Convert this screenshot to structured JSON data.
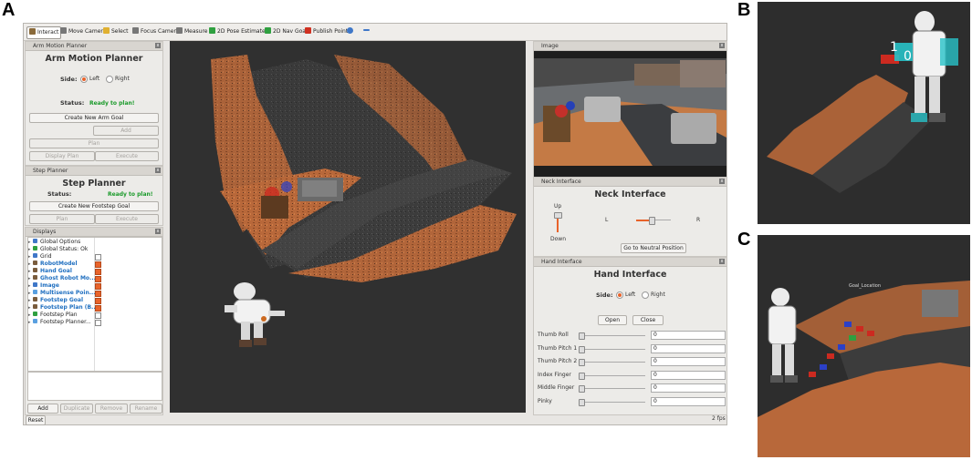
{
  "figure_letters": {
    "a": "A",
    "b": "B",
    "c": "C"
  },
  "toolbar": [
    {
      "label": "Interact",
      "icon": "hand-icon",
      "color": "#8a6a3a"
    },
    {
      "label": "Move Camera",
      "icon": "move-camera-icon",
      "color": "#777777"
    },
    {
      "label": "Select",
      "icon": "select-icon",
      "color": "#e0b030"
    },
    {
      "label": "Focus Camera",
      "icon": "focus-camera-icon",
      "color": "#777777"
    },
    {
      "label": "Measure",
      "icon": "measure-icon",
      "color": "#777777"
    },
    {
      "label": "2D Pose Estimate",
      "icon": "pose-estimate-icon",
      "color": "#2fa040"
    },
    {
      "label": "2D Nav Goal",
      "icon": "nav-goal-icon",
      "color": "#2fa040"
    },
    {
      "label": "Publish Point",
      "icon": "publish-point-icon",
      "color": "#d03020"
    }
  ],
  "arm_planner": {
    "panel_title": "Arm Motion Planner",
    "heading": "Arm Motion Planner",
    "side_label": "Side:",
    "left": "Left",
    "right": "Right",
    "status_label": "Status:",
    "status_value": "Ready to plan!",
    "create_goal": "Create New Arm Goal",
    "add": "Add",
    "plan": "Plan",
    "display_plan": "Display Plan",
    "execute": "Execute"
  },
  "step_planner": {
    "panel_title": "Step Planner",
    "heading": "Step Planner",
    "status_label": "Status:",
    "status_value": "Ready to plan!",
    "create_goal": "Create New Footstep Goal",
    "plan": "Plan",
    "execute": "Execute"
  },
  "displays": {
    "panel_title": "Displays",
    "items": [
      {
        "label": "Global Options",
        "icon_color": "#3f77c8",
        "checkbox": "none",
        "blue": false
      },
      {
        "label": "Global Status: Ok",
        "icon_color": "#2fa040",
        "checkbox": "none",
        "blue": false
      },
      {
        "label": "Grid",
        "icon_color": "#3f77c8",
        "checkbox": "off",
        "blue": false
      },
      {
        "label": "RobotModel",
        "icon_color": "#7a5c3c",
        "checkbox": "on",
        "blue": true
      },
      {
        "label": "Hand Goal",
        "icon_color": "#7a5c3c",
        "checkbox": "on",
        "blue": true
      },
      {
        "label": "Ghost Robot Mo...",
        "icon_color": "#7a5c3c",
        "checkbox": "on",
        "blue": true
      },
      {
        "label": "Image",
        "icon_color": "#3f77c8",
        "checkbox": "on",
        "blue": true
      },
      {
        "label": "Multisense Poin...",
        "icon_color": "#5aa0e0",
        "checkbox": "on",
        "blue": true
      },
      {
        "label": "Footstep Goal",
        "icon_color": "#7a5c3c",
        "checkbox": "on",
        "blue": true
      },
      {
        "label": "Footstep Plan (B...",
        "icon_color": "#7a5c3c",
        "checkbox": "on",
        "blue": true
      },
      {
        "label": "Footstep Plan",
        "icon_color": "#2fa040",
        "checkbox": "off",
        "blue": false
      },
      {
        "label": "Footstep Planner...",
        "icon_color": "#5aa0e0",
        "checkbox": "off",
        "blue": false
      }
    ],
    "add": "Add",
    "duplicate": "Duplicate",
    "remove": "Remove",
    "rename": "Rename"
  },
  "reset": "Reset",
  "fps": "2 fps",
  "image_panel": {
    "panel_title": "Image"
  },
  "neck": {
    "panel_title": "Neck Interface",
    "heading": "Neck Interface",
    "up": "Up",
    "down": "Down",
    "l": "L",
    "r": "R",
    "neutral": "Go to Neutral Position"
  },
  "hand": {
    "panel_title": "Hand Interface",
    "heading": "Hand Interface",
    "side_label": "Side:",
    "left": "Left",
    "right": "Right",
    "open": "Open",
    "close": "Close",
    "joints": [
      {
        "label": "Thumb Roll",
        "value": "0"
      },
      {
        "label": "Thumb Pitch 1",
        "value": "0"
      },
      {
        "label": "Thumb Pitch 2",
        "value": "0"
      },
      {
        "label": "Index Finger",
        "value": "0"
      },
      {
        "label": "Middle Finger",
        "value": "0"
      },
      {
        "label": "Pinky",
        "value": "0"
      }
    ]
  },
  "panel_b": {
    "label_1": "1",
    "label_0": "0"
  },
  "panel_c": {
    "goal_text": "Goal_Location"
  }
}
